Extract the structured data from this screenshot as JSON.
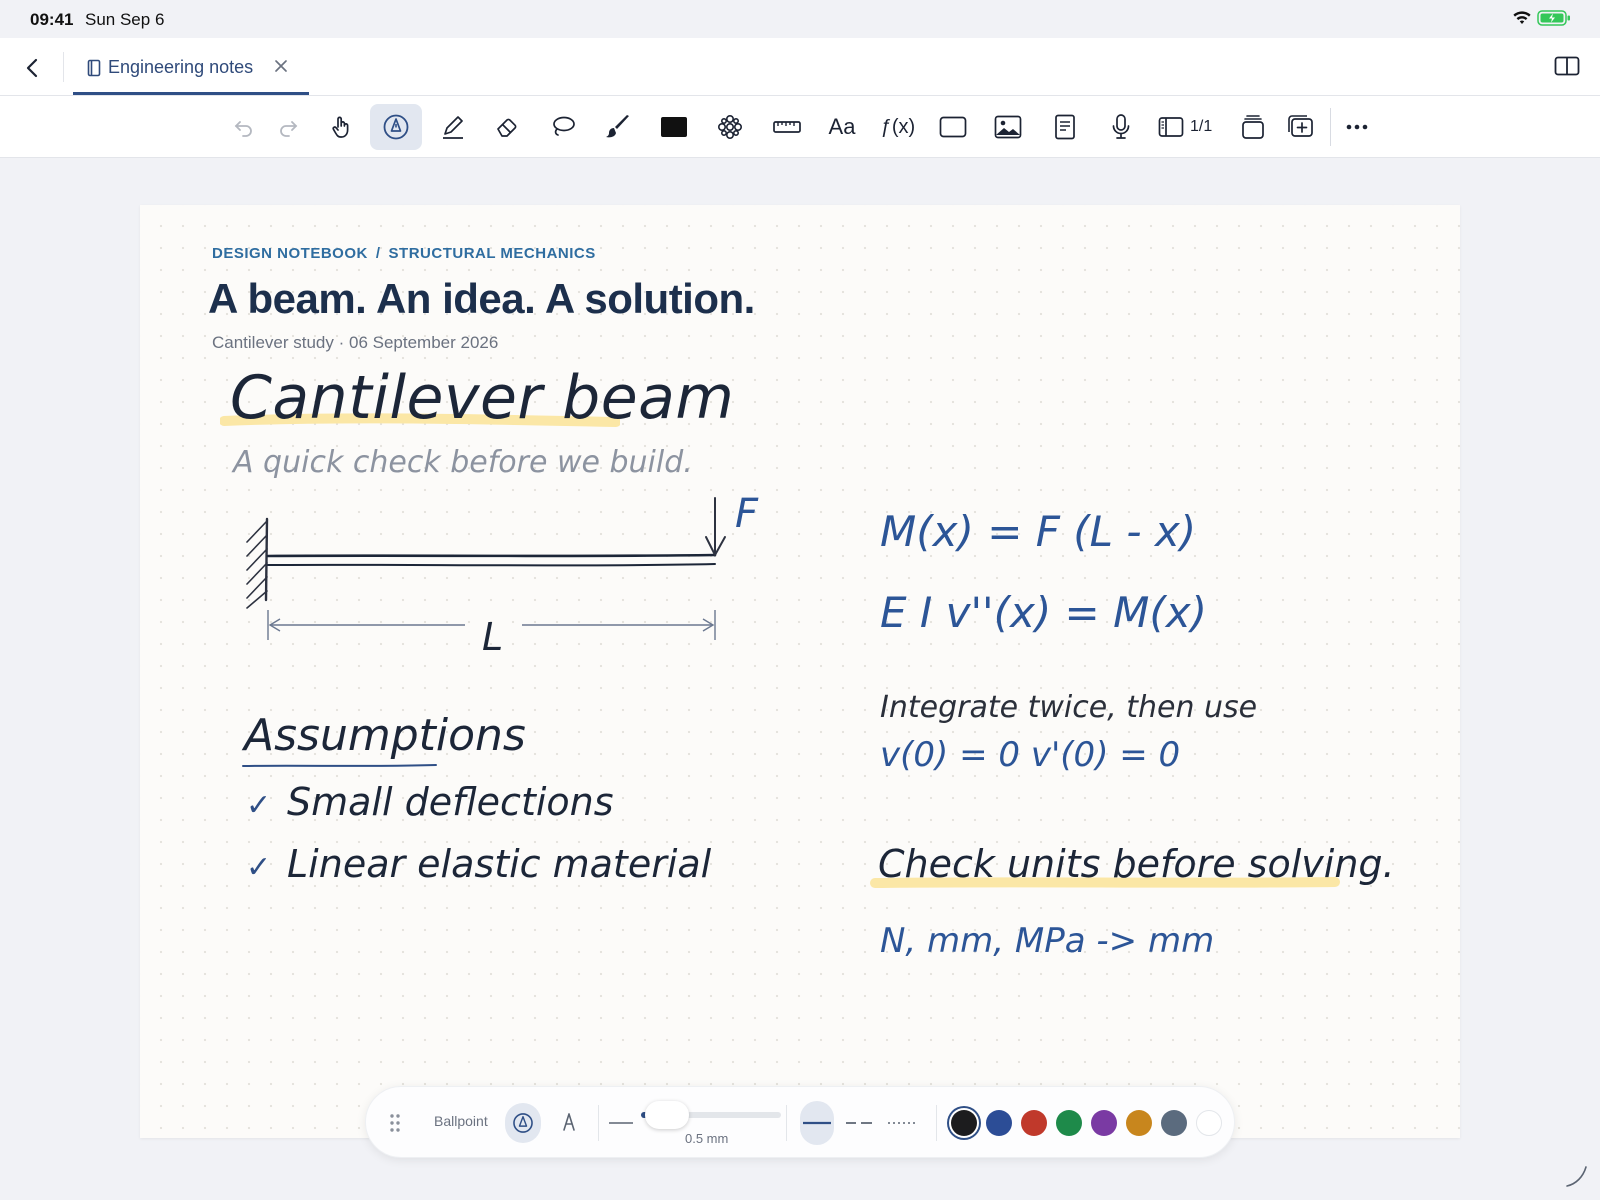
{
  "status": {
    "time": "09:41",
    "date": "Sun Sep 6"
  },
  "tab": {
    "title": "Engineering notes"
  },
  "toolbar": {
    "text_tool": "Aa",
    "math_tool": "ƒ(x)",
    "page_count": "1/1"
  },
  "page": {
    "breadcrumb_1": "DESIGN NOTEBOOK",
    "breadcrumb_sep": "/",
    "breadcrumb_2": "STRUCTURAL MECHANICS",
    "heading": "A beam. An idea. A solution.",
    "meta": "Cantilever study · 06 September 2026",
    "hand_title": "Cantilever beam",
    "hand_subtitle": "A quick check before we build.",
    "force_label": "F",
    "length_label": "L",
    "eq1": "M(x) = F (L - x)",
    "eq2": "E I v''(x) = M(x)",
    "note": "Integrate twice, then use",
    "bc": "v(0) = 0    v'(0) = 0",
    "assumptions_title": "Assumptions",
    "assumptions": [
      "Small deflections",
      "Linear elastic material"
    ],
    "callout": "Check units before solving.",
    "units": "N, mm, MPa  ->  mm"
  },
  "penbar": {
    "pen_name": "Ballpoint",
    "size_label": "0.5 mm",
    "size_fraction": 0.03,
    "colors": [
      "#1c1c1e",
      "#2c4d96",
      "#c0392b",
      "#1e8a4a",
      "#7a3aa3",
      "#c8861d",
      "#5b6b7e",
      "#ffffff"
    ],
    "selected_color": 0
  }
}
